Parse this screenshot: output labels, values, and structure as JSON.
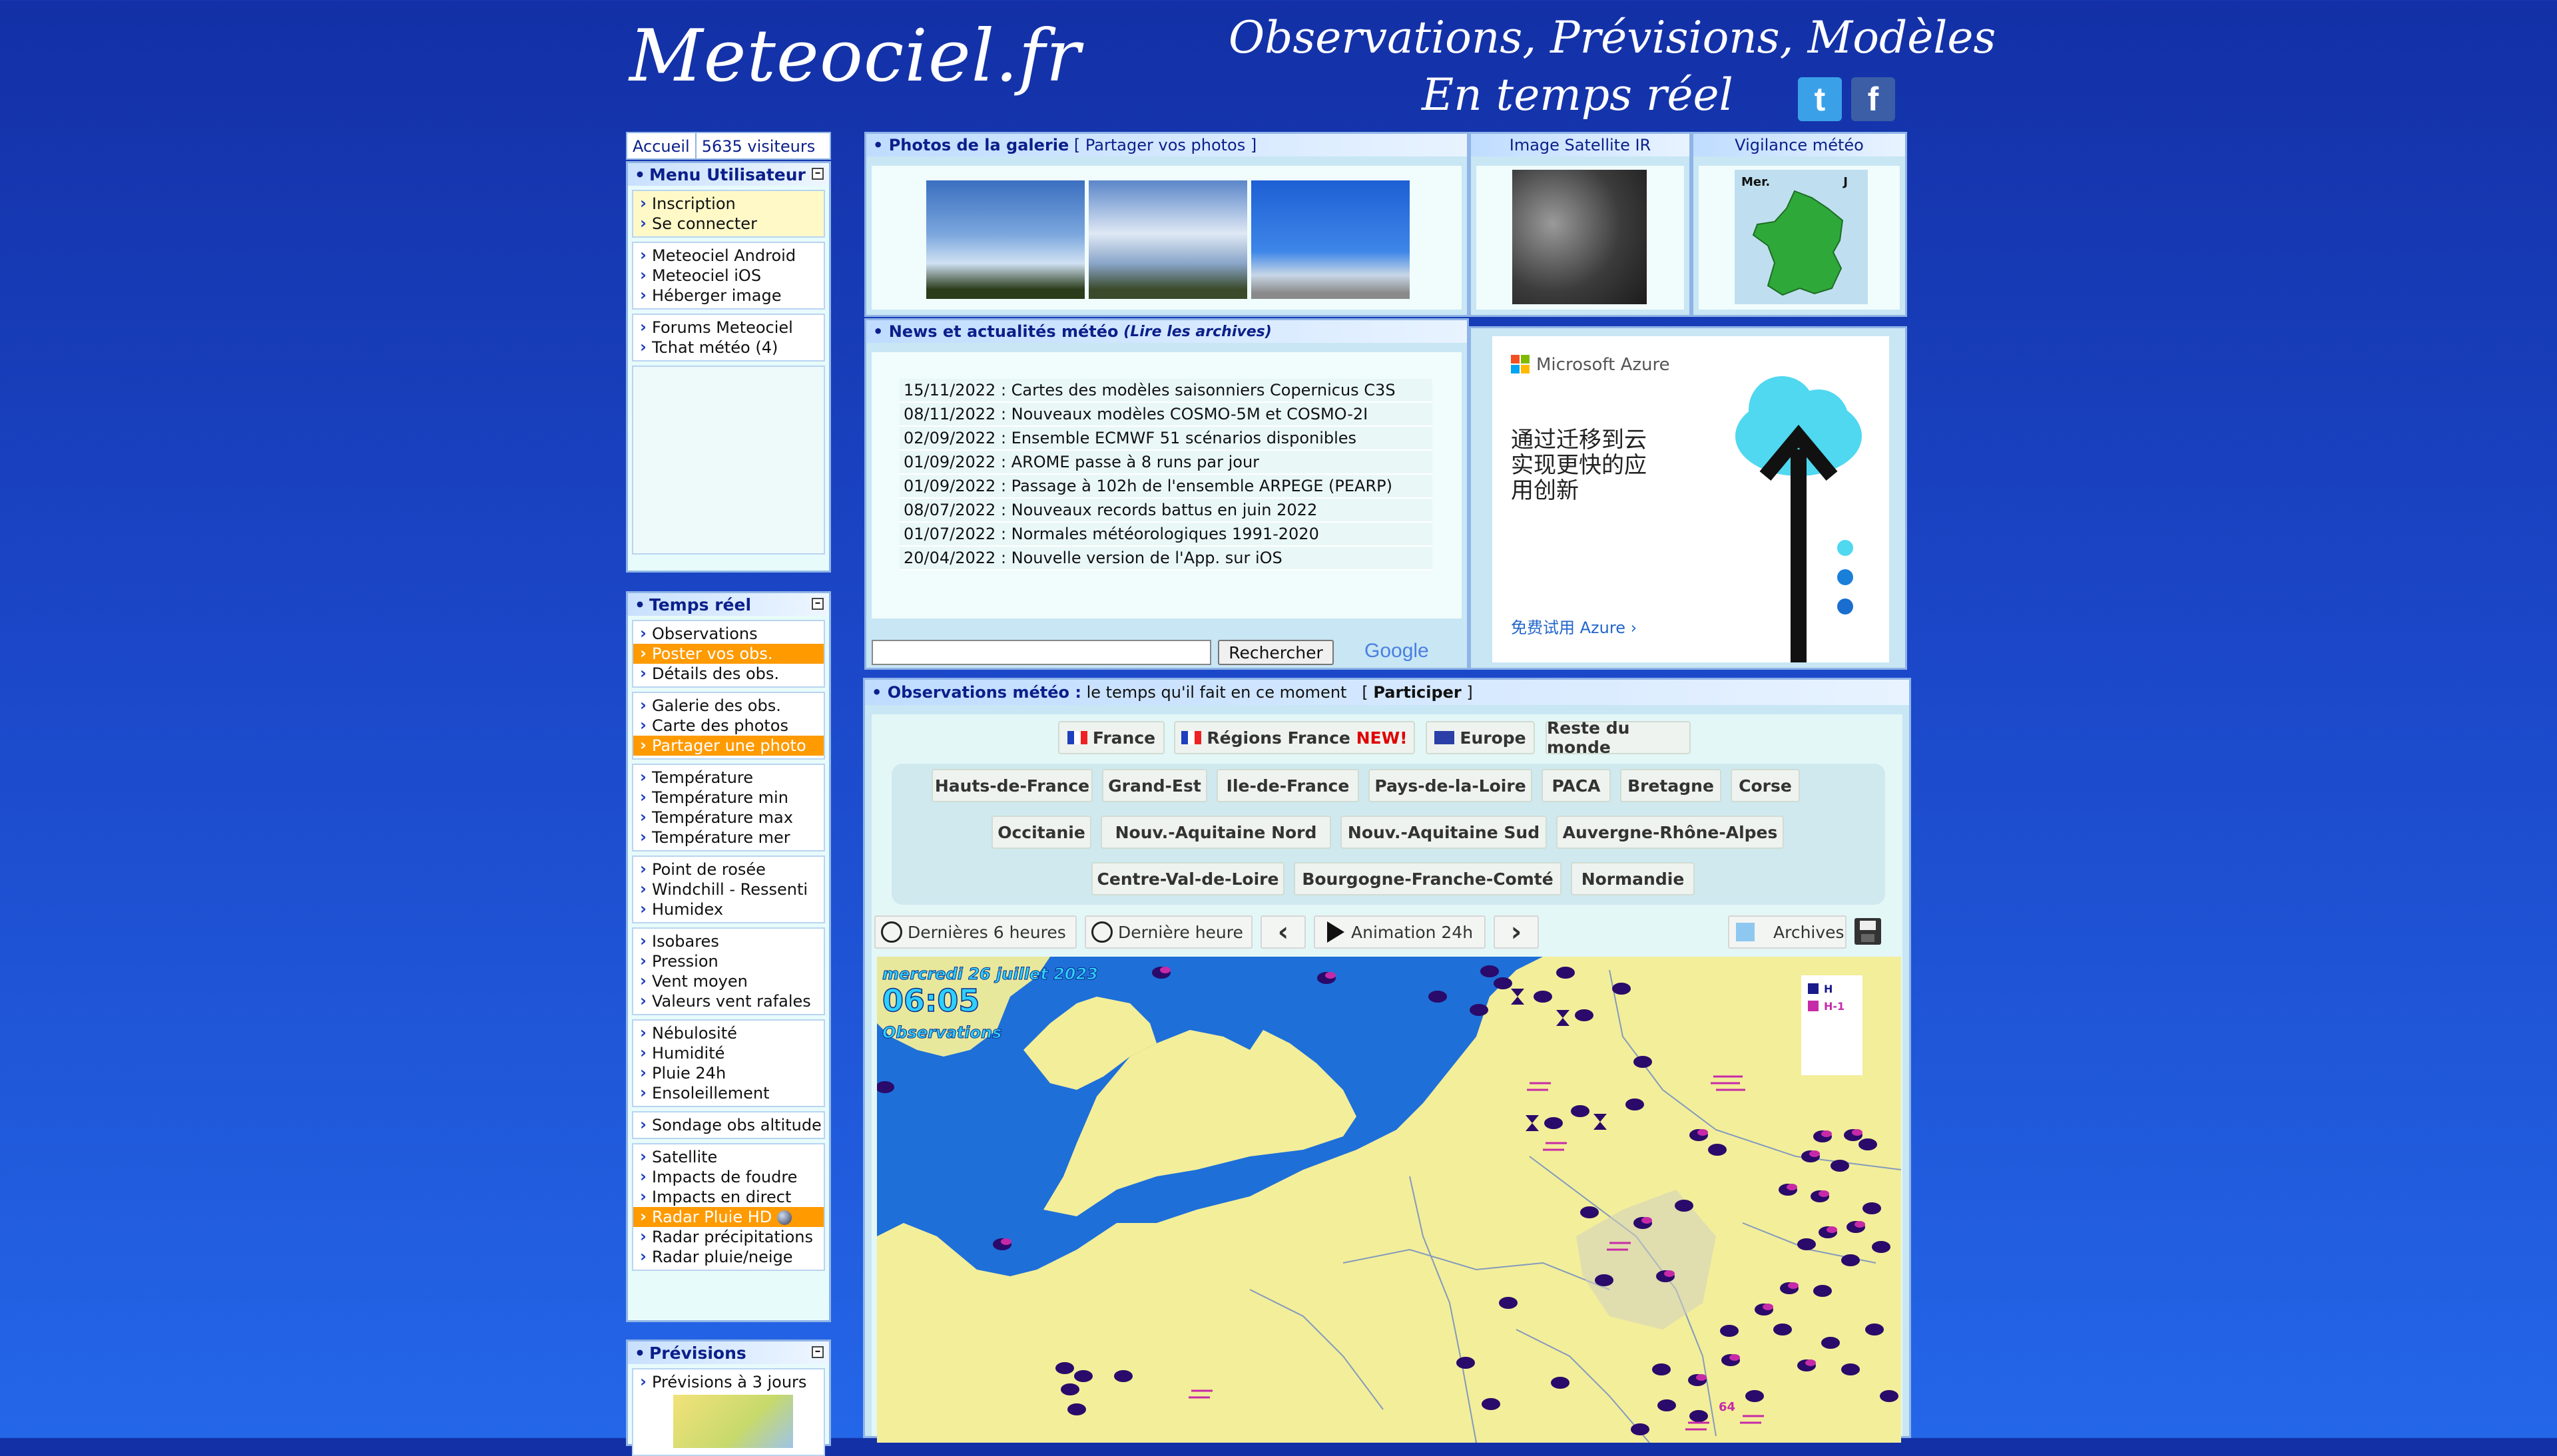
{
  "header": {
    "logo": "Meteociel.fr",
    "tagline_line1": "Observations, Prévisions, Modèles",
    "tagline_line2": "En temps réel",
    "social": [
      {
        "name": "twitter",
        "glyph": "t"
      },
      {
        "name": "facebook",
        "glyph": "f"
      }
    ]
  },
  "topbar": {
    "home": "Accueil",
    "visitors": "5635 visiteurs"
  },
  "menu_user": {
    "title": "Menu Utilisateur",
    "groups": [
      [
        "Inscription",
        "Se connecter"
      ],
      [
        "Meteociel Android",
        "Meteociel iOS",
        "Héberger image"
      ],
      [
        "Forums Meteociel",
        "Tchat météo (4)"
      ]
    ]
  },
  "temps_reel": {
    "title": "Temps réel",
    "groups": [
      [
        "Observations",
        "Poster vos obs.",
        "Détails des obs."
      ],
      [
        "Galerie des obs.",
        "Carte des photos",
        "Partager une photo"
      ],
      [
        "Température",
        "Température min",
        "Température max",
        "Température mer"
      ],
      [
        "Point de rosée",
        "Windchill - Ressenti",
        "Humidex"
      ],
      [
        "Isobares",
        "Pression",
        "Vent moyen",
        "Valeurs vent rafales"
      ],
      [
        "Nébulosité",
        "Humidité",
        "Pluie 24h",
        "Ensoleillement"
      ],
      [
        "Sondage obs altitude"
      ],
      [
        "Satellite",
        "Impacts de foudre",
        "Impacts en direct",
        "Radar Pluie HD",
        "Radar précipitations",
        "Radar pluie/neige"
      ]
    ]
  },
  "previsions": {
    "title": "Prévisions",
    "items": [
      "Prévisions à 3 jours"
    ]
  },
  "gallery": {
    "title": "Photos de la galerie",
    "link": "[ Partager vos photos ]"
  },
  "satellite": {
    "title": "Image Satellite IR"
  },
  "vigilance": {
    "title": "Vigilance météo",
    "label_left": "Mer.",
    "label_right": "J"
  },
  "news": {
    "title": "News et actualités météo",
    "archives": "(Lire les archives)",
    "items": [
      "15/11/2022 : Cartes des modèles saisonniers Copernicus C3S",
      "08/11/2022 : Nouveaux modèles COSMO-5M et COSMO-2I",
      "02/09/2022 : Ensemble ECMWF 51 scénarios disponibles",
      "01/09/2022 : AROME passe à 8 runs par jour",
      "01/09/2022 : Passage à 102h de l'ensemble ARPEGE (PEARP)",
      "08/07/2022 : Nouveaux records battus en juin 2022",
      "01/07/2022 : Normales météorologiques 1991-2020",
      "20/04/2022 : Nouvelle version de l'App. sur iOS"
    ],
    "search_button": "Rechercher",
    "search_placeholder": "",
    "google": "Google"
  },
  "ad": {
    "brand": "Microsoft Azure",
    "text_line1": "通过迁移到云",
    "text_line2": "实现更快的应",
    "text_line3": "用创新",
    "cta": "免费试用 Azure ›"
  },
  "observations": {
    "title": "Observations météo :",
    "subtitle": "le temps qu'il fait en ce moment",
    "participate": "Participer",
    "tabs": [
      {
        "label": "France",
        "badge": ""
      },
      {
        "label": "Régions France",
        "badge": "NEW!"
      },
      {
        "label": "Europe",
        "badge": ""
      },
      {
        "label": "Reste du monde",
        "badge": ""
      }
    ],
    "regions_row1": [
      "Hauts-de-France",
      "Grand-Est",
      "Ile-de-France",
      "Pays-de-la-Loire",
      "PACA",
      "Bretagne",
      "Corse"
    ],
    "regions_row2": [
      "Occitanie",
      "Nouv.-Aquitaine Nord",
      "Nouv.-Aquitaine Sud",
      "Auvergne-Rhône-Alpes"
    ],
    "regions_row3": [
      "Centre-Val-de-Loire",
      "Bourgogne-Franche-Comté",
      "Normandie"
    ],
    "controls": {
      "last6": "Dernières 6 heures",
      "last1": "Dernière heure",
      "animation": "Animation 24h",
      "archives": "Archives"
    },
    "map": {
      "date": "mercredi 26 juillet 2023",
      "time": "06:05",
      "caption": "Observations",
      "legend_h": "H",
      "legend_h1": "H-1",
      "sample_value": "64"
    }
  },
  "colors": {
    "accent": "#ff9a00",
    "title_blue": "#0b1f8a",
    "badge_red": "#e00000",
    "map_land": "#f3ee9a",
    "map_sea": "#1e6fd8"
  }
}
